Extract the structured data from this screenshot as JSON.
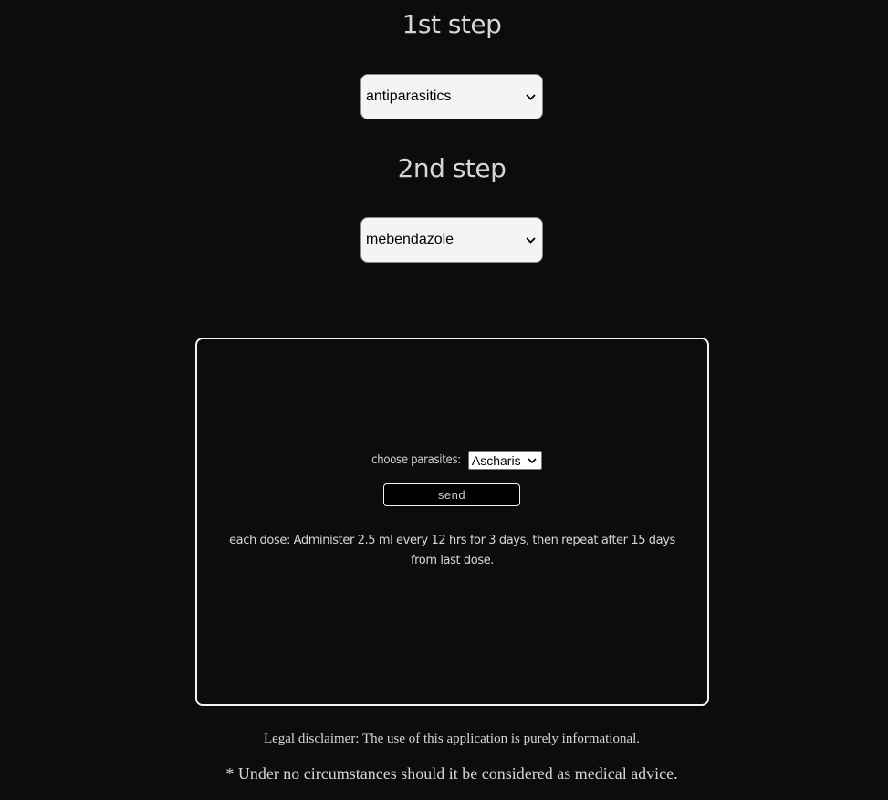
{
  "step1": {
    "title": "1st step",
    "selected": "antiparasitics"
  },
  "step2": {
    "title": "2nd step",
    "selected": "mebendazole"
  },
  "card": {
    "parasite_label": "choose parasites:",
    "parasite_selected": "Ascharis",
    "send_label": "send",
    "dose_text": "each dose: Administer 2.5 ml every 12 hrs for 3 days, then repeat after 15 days from last dose."
  },
  "disclaimer": {
    "line1": "Legal disclaimer: The use of this application is purely informational.",
    "line2": "* Under no circumstances should it be considered as medical advice."
  },
  "icons": {
    "select_arrow": "chevron-down-icon"
  },
  "colors": {
    "background": "#0c0c0c",
    "text": "#d6d6d6",
    "card_border": "#f2f2f2",
    "select_bg": "#f4f4f4"
  }
}
